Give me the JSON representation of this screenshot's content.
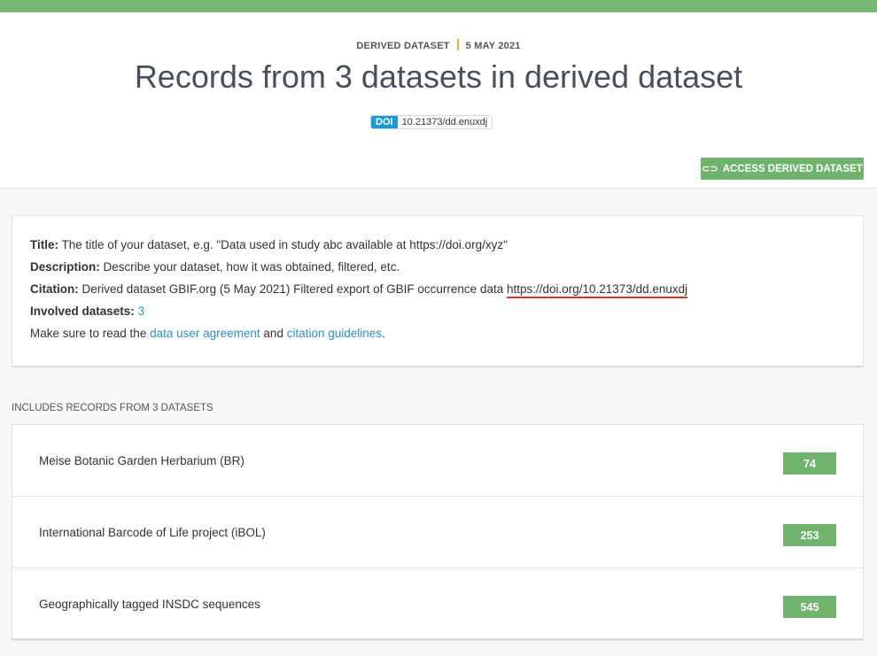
{
  "header": {
    "kicker_type": "DERIVED DATASET",
    "kicker_date": "5 MAY 2021",
    "title": "Records from 3 datasets in derived dataset",
    "doi_label": "DOI",
    "doi_value": "10.21373/dd.enuxdj",
    "access_button": "ACCESS DERIVED DATASET",
    "access_icon": "link-icon"
  },
  "info": {
    "title_label": "Title:",
    "title_value": " The title of your dataset, e.g. \"Data used in study abc available at https://doi.org/xyz\"",
    "description_label": "Description:",
    "description_value": " Describe your dataset, how it was obtained, filtered, etc.",
    "citation_label": "Citation:",
    "citation_value": " Derived dataset GBIF.org (5 May 2021) Filtered export of GBIF occurrence data ",
    "citation_link": "https://doi.org/10.21373/dd.enuxdj",
    "involved_label": "Involved datasets:",
    "involved_count": "3",
    "agreement_prefix": "Make sure to read the ",
    "agreement_link": "data user agreement",
    "agreement_and": " and ",
    "citation_guidelines_link": "citation guidelines",
    "agreement_suffix": "."
  },
  "datasets_section": {
    "label": "INCLUDES RECORDS FROM 3 DATASETS",
    "items": [
      {
        "name": "Meise Botanic Garden Herbarium (BR)",
        "count": "74"
      },
      {
        "name": "International Barcode of Life project (iBOL)",
        "count": "253"
      },
      {
        "name": "Geographically tagged INSDC sequences",
        "count": "545"
      }
    ]
  },
  "colors": {
    "brand_green": "#77b675",
    "doi_blue": "#1a9ad6",
    "link_blue": "#2f8ec4",
    "separator_yellow": "#e8b12c",
    "highlight_red": "#e0322c"
  }
}
